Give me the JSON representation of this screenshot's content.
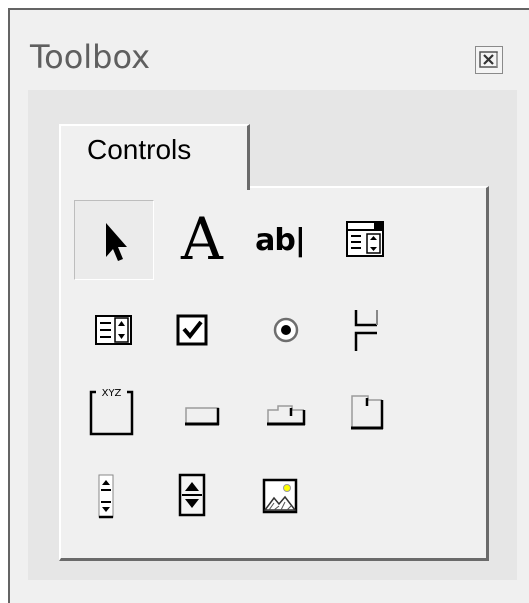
{
  "window": {
    "title": "Toolbox",
    "close_icon": "close-icon"
  },
  "tabs": [
    {
      "label": "Controls",
      "active": true
    }
  ],
  "tools": [
    {
      "name": "select-objects-tool",
      "icon": "arrow-pointer-icon",
      "selected": true
    },
    {
      "name": "label-tool",
      "icon": "label-A-icon",
      "glyph": "A"
    },
    {
      "name": "textbox-tool",
      "icon": "textbox-icon",
      "glyph": "ab|"
    },
    {
      "name": "combobox-tool",
      "icon": "combobox-icon"
    },
    {
      "name": "listbox-tool",
      "icon": "listbox-icon"
    },
    {
      "name": "checkbox-tool",
      "icon": "checkbox-icon"
    },
    {
      "name": "optionbutton-tool",
      "icon": "option-button-icon"
    },
    {
      "name": "togglebutton-tool",
      "icon": "toggle-button-icon"
    },
    {
      "name": "frame-tool",
      "icon": "frame-icon",
      "glyph": "XYZ"
    },
    {
      "name": "commandbutton-tool",
      "icon": "command-button-icon"
    },
    {
      "name": "tabstrip-tool",
      "icon": "tabstrip-icon"
    },
    {
      "name": "multipage-tool",
      "icon": "multipage-icon"
    },
    {
      "name": "scrollbar-tool",
      "icon": "scrollbar-icon"
    },
    {
      "name": "spinbutton-tool",
      "icon": "spin-button-icon"
    },
    {
      "name": "image-tool",
      "icon": "image-icon"
    }
  ],
  "colors": {
    "window_bg": "#f0f0f0",
    "panel_bg": "#e6e6e6",
    "border_dark": "#646464",
    "title_text": "#5f5f5f",
    "image_sun": "#ffff00"
  }
}
